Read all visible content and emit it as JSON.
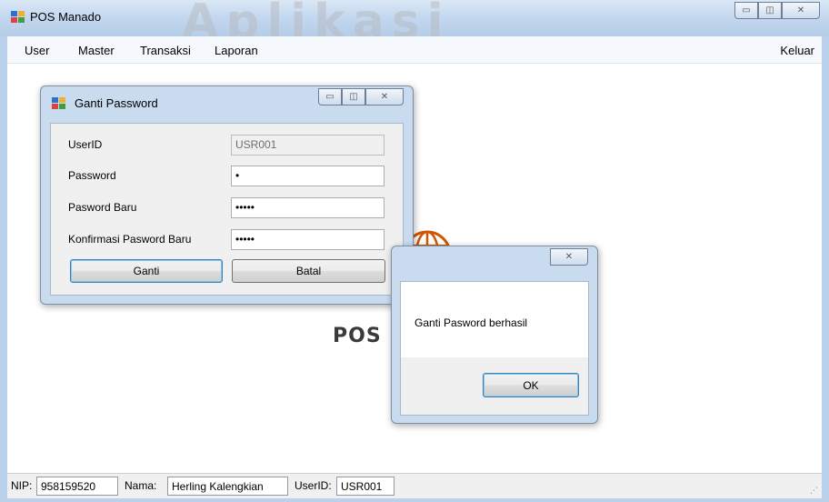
{
  "window": {
    "title": "POS Manado",
    "background_text": "Aplikasi"
  },
  "menu": {
    "items": [
      {
        "label": "User"
      },
      {
        "label": "Master"
      },
      {
        "label": "Transaksi"
      },
      {
        "label": "Laporan"
      }
    ],
    "right_item": "Keluar"
  },
  "background_logo_text": "POS I",
  "dialog": {
    "title": "Ganti Password",
    "fields": {
      "userid_label": "UserID",
      "userid_value": "USR001",
      "password_label": "Password",
      "password_value": "•",
      "new_password_label": "Pasword Baru",
      "new_password_value": "•••••",
      "confirm_label": "Konfirmasi Pasword Baru",
      "confirm_value": "•••••"
    },
    "buttons": {
      "ganti": "Ganti",
      "batal": "Batal"
    }
  },
  "message_box": {
    "text": "Ganti Pasword berhasil",
    "ok_label": "OK"
  },
  "status": {
    "nip_label": "NIP:",
    "nip_value": "958159520",
    "nama_label": "Nama:",
    "nama_value": "Herling Kalengkian",
    "userid_label": "UserID:",
    "userid_value": "USR001"
  },
  "colors": {
    "window_frame": "#b9d1ea",
    "accent_logo": "#d35400"
  }
}
